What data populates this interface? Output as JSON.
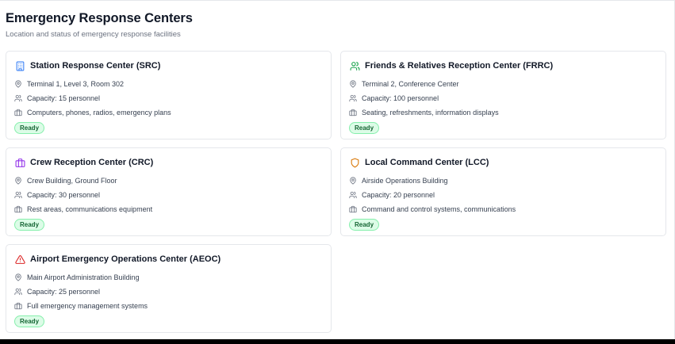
{
  "page": {
    "title": "Emergency Response Centers",
    "subtitle": "Location and status of emergency response facilities"
  },
  "colors": {
    "blue": "#3b82f6",
    "green": "#16a34a",
    "purple": "#9333ea",
    "orange": "#d97706",
    "red": "#dc2626",
    "badge_bg": "#dcfce7",
    "badge_text": "#166534"
  },
  "cards": [
    {
      "title": "Station Response Center (SRC)",
      "title_icon": "building-icon",
      "location": "Terminal 1, Level 3, Room 302",
      "capacity": "Capacity: 15 personnel",
      "equipment": "Computers, phones, radios, emergency plans",
      "status": "Ready"
    },
    {
      "title": "Friends & Relatives Reception Center (FRRC)",
      "title_icon": "users-icon",
      "location": "Terminal 2, Conference Center",
      "capacity": "Capacity: 100 personnel",
      "equipment": "Seating, refreshments, information displays",
      "status": "Ready"
    },
    {
      "title": "Crew Reception Center (CRC)",
      "title_icon": "briefcase-icon",
      "location": "Crew Building, Ground Floor",
      "capacity": "Capacity: 30 personnel",
      "equipment": "Rest areas, communications equipment",
      "status": "Ready"
    },
    {
      "title": "Local Command Center (LCC)",
      "title_icon": "shield-icon",
      "location": "Airside Operations Building",
      "capacity": "Capacity: 20 personnel",
      "equipment": "Command and control systems, communications",
      "status": "Ready"
    },
    {
      "title": "Airport Emergency Operations Center (AEOC)",
      "title_icon": "alert-triangle-icon",
      "location": "Main Airport Administration Building",
      "capacity": "Capacity: 25 personnel",
      "equipment": "Full emergency management systems",
      "status": "Ready"
    }
  ]
}
